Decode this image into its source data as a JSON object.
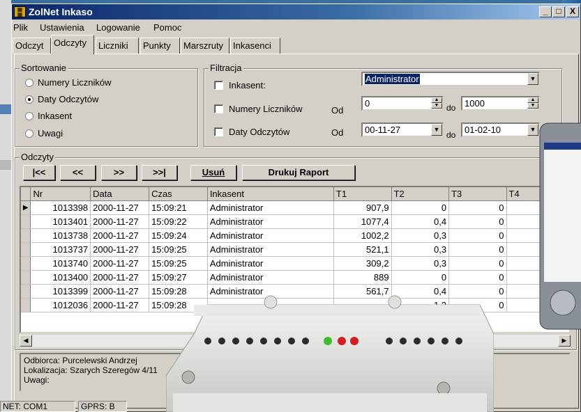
{
  "window": {
    "title": "ZolNet Inkaso",
    "min": "_",
    "max": "□",
    "close": "X"
  },
  "menu": [
    "Plik",
    "Ustawienia",
    "Logowanie",
    "Pomoc"
  ],
  "tabs": [
    "Odczyt",
    "Odczyty",
    "Liczniki",
    "Punkty",
    "Marszruty",
    "Inkasenci"
  ],
  "active_tab": "Odczyty",
  "sort": {
    "title": "Sortowanie",
    "options": [
      "Numery Liczników",
      "Daty Odczytów",
      "Inkasent",
      "Uwagi"
    ],
    "selected": "Daty Odczytów"
  },
  "filter": {
    "title": "Filtracja",
    "inkasent_label": "Inkasent:",
    "inkasent_value": "Administrator",
    "numery_label": "Numery Liczników",
    "daty_label": "Daty Odczytów",
    "od": "Od",
    "do": "do",
    "numery_from": "0",
    "numery_to": "1000",
    "daty_from": "00-11-27",
    "daty_to": "01-02-10"
  },
  "odczyty": {
    "title": "Odczyty",
    "nav": [
      "|<<",
      "<<",
      ">>",
      ">>|"
    ],
    "delete": "Usuń",
    "print": "Drukuj Raport"
  },
  "table": {
    "columns": [
      "Nr",
      "Data",
      "Czas",
      "Inkasent",
      "T1",
      "T2",
      "T3",
      "T4"
    ],
    "rows": [
      [
        "1013398",
        "2000-11-27",
        "15:09:21",
        "Administrator",
        "907,9",
        "0",
        "0",
        ""
      ],
      [
        "1013401",
        "2000-11-27",
        "15:09:22",
        "Administrator",
        "1077,4",
        "0,4",
        "0",
        ""
      ],
      [
        "1013738",
        "2000-11-27",
        "15:09:24",
        "Administrator",
        "1002,2",
        "0,3",
        "0",
        ""
      ],
      [
        "1013737",
        "2000-11-27",
        "15:09:25",
        "Administrator",
        "521,1",
        "0,3",
        "0",
        ""
      ],
      [
        "1013740",
        "2000-11-27",
        "15:09:25",
        "Administrator",
        "309,2",
        "0,3",
        "0",
        ""
      ],
      [
        "1013400",
        "2000-11-27",
        "15:09:27",
        "Administrator",
        "889",
        "0",
        "0",
        ""
      ],
      [
        "1013399",
        "2000-11-27",
        "15:09:28",
        "Administrator",
        "561,7",
        "0,4",
        "0",
        ""
      ],
      [
        "1012036",
        "2000-11-27",
        "15:09:28",
        "",
        "",
        "1,3",
        "0",
        ""
      ]
    ]
  },
  "info": {
    "odbiorca": "Odbiorca: Purcelewski Andrzej",
    "lokalizacja": "Lokalizacja: Szarych Szeregów 4/11",
    "uwagi": "Uwagi:"
  },
  "status": {
    "left": "NET: COM1",
    "right": "GPRS: B"
  },
  "colors": {
    "titlebar": "#0a246a",
    "window": "#d4d0c8",
    "background": "#3a6fa4"
  }
}
